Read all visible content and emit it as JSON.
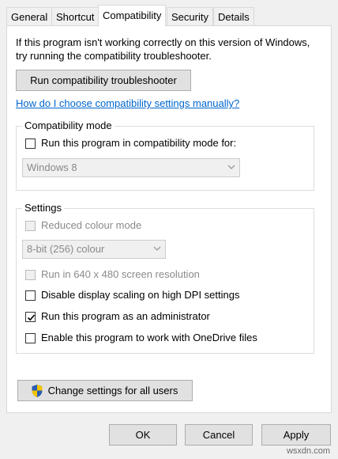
{
  "tabs": [
    {
      "label": "General"
    },
    {
      "label": "Shortcut"
    },
    {
      "label": "Compatibility"
    },
    {
      "label": "Security"
    },
    {
      "label": "Details"
    }
  ],
  "active_tab": "Compatibility",
  "intro": {
    "line1": "If this program isn't working correctly on this version of Windows,",
    "line2": "try running the compatibility troubleshooter."
  },
  "troubleshooter_button": "Run compatibility troubleshooter",
  "manual_link": "How do I choose compatibility settings manually?",
  "compat_mode": {
    "legend": "Compatibility mode",
    "checkbox_label": "Run this program in compatibility mode for:",
    "checked": false,
    "os_select": "Windows 8"
  },
  "settings": {
    "legend": "Settings",
    "reduced_colour": {
      "label": "Reduced colour mode",
      "checked": false,
      "enabled": false
    },
    "colour_select": "8-bit (256) colour",
    "res_640": {
      "label": "Run in 640 x 480 screen resolution",
      "checked": false,
      "enabled": false
    },
    "dpi_scaling": {
      "label": "Disable display scaling on high DPI settings",
      "checked": false,
      "enabled": true
    },
    "run_admin": {
      "label": "Run this program as an administrator",
      "checked": true,
      "enabled": true
    },
    "onedrive": {
      "label": "Enable this program to work with OneDrive files",
      "checked": false,
      "enabled": true
    }
  },
  "change_all_users_button": "Change settings for all users",
  "footer": {
    "ok": "OK",
    "cancel": "Cancel",
    "apply": "Apply"
  },
  "watermark": "wsxdn.com",
  "colors": {
    "link": "#0066cc",
    "accent": "#0078d7",
    "shield_blue": "#2a5db0",
    "shield_yellow": "#f5c400"
  }
}
